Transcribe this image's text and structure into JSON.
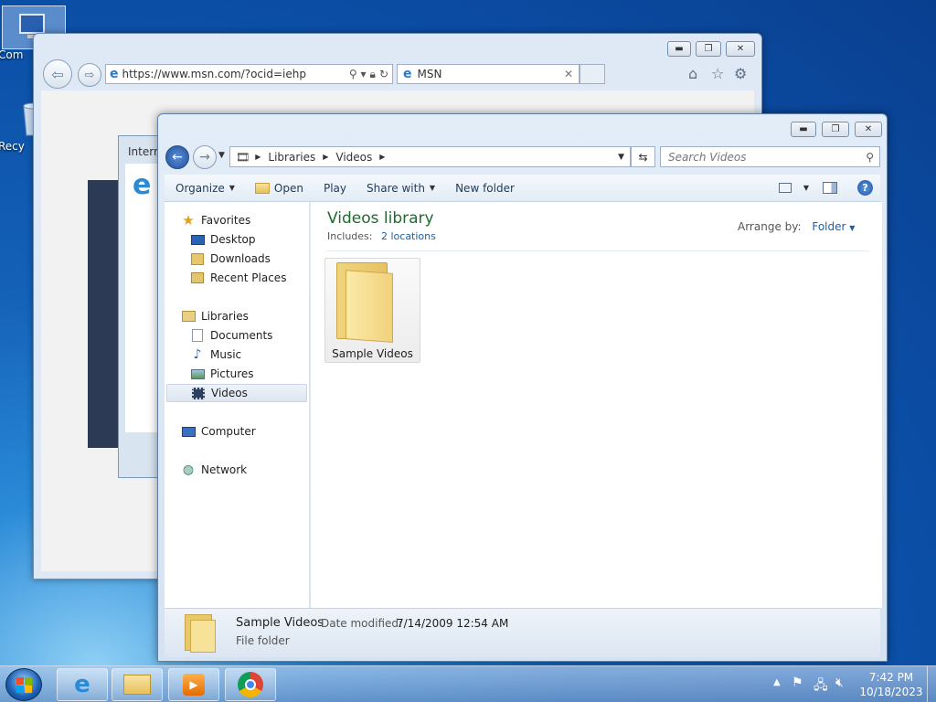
{
  "desktop": {
    "icons": [
      {
        "label": "Com",
        "icon": "computer-icon"
      },
      {
        "label": "Recy",
        "icon": "recycle-bin-icon"
      }
    ]
  },
  "ie": {
    "url": "https://www.msn.com/?ocid=iehp",
    "tab_title": "MSN",
    "dialog_title": "Intern"
  },
  "explorer": {
    "breadcrumb": [
      "Libraries",
      "Videos"
    ],
    "search_placeholder": "Search Videos",
    "toolbar": {
      "organize": "Organize",
      "open": "Open",
      "play": "Play",
      "share_with": "Share with",
      "new_folder": "New folder"
    },
    "nav": {
      "favorites": "Favorites",
      "favorites_items": [
        "Desktop",
        "Downloads",
        "Recent Places"
      ],
      "libraries": "Libraries",
      "libraries_items": [
        "Documents",
        "Music",
        "Pictures",
        "Videos"
      ],
      "computer": "Computer",
      "network": "Network",
      "selected": "Videos"
    },
    "library": {
      "title": "Videos library",
      "includes_label": "Includes:",
      "includes_link": "2 locations",
      "arrange_label": "Arrange by:",
      "arrange_value": "Folder"
    },
    "items": [
      {
        "name": "Sample Videos"
      }
    ],
    "details": {
      "name": "Sample Videos",
      "date_label": "Date modified:",
      "date_value": "7/14/2009 12:54 AM",
      "type": "File folder"
    }
  },
  "taskbar": {
    "time": "7:42 PM",
    "date": "10/18/2023",
    "pinned": [
      "internet-explorer-icon",
      "windows-explorer-icon",
      "media-player-icon",
      "chrome-icon"
    ]
  },
  "colors": {
    "library_title": "#1e6b2e",
    "link": "#1f5fa6"
  }
}
